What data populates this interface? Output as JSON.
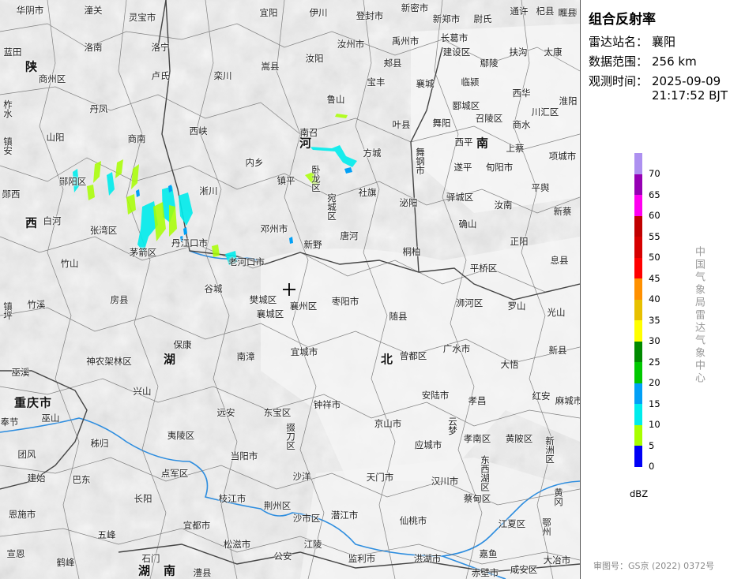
{
  "panel": {
    "title": "组合反射率",
    "station_label": "雷达站名：",
    "station_value": "襄阳",
    "range_label": "数据范围：",
    "range_value": "256 km",
    "time_label": "观测时间：",
    "time_date": "2025-09-09",
    "time_clock": "21:17:52 BJT",
    "agency": "中国气象局雷达气象中心",
    "approval": "审图号：GS京 (2022) 0372号"
  },
  "legend": {
    "unit": "dBZ",
    "ticks": [
      "70",
      "65",
      "60",
      "55",
      "50",
      "45",
      "40",
      "35",
      "30",
      "25",
      "20",
      "15",
      "10",
      "5",
      "0"
    ],
    "colors": [
      "#ad90f0",
      "#9600b4",
      "#ff00f0",
      "#c00000",
      "#d60000",
      "#ff0000",
      "#ff9000",
      "#e7c000",
      "#ffff00",
      "#008a00",
      "#00c800",
      "#01a0f6",
      "#00ecec",
      "#a8ff00",
      "#0000f6"
    ]
  },
  "regions": [
    "陕",
    "西",
    "重庆市",
    "湖",
    "北",
    "湖",
    "南",
    "河",
    "南"
  ],
  "places": [
    "华阴市",
    "潼关",
    "灵宝市",
    "偃师",
    "宜阳",
    "伊川",
    "登封市",
    "新密市",
    "新郑市",
    "尉氏",
    "通许",
    "杞县",
    "睢县",
    "蓝田",
    "洛南",
    "洛宁",
    "嵩县",
    "汝阳",
    "汝州市",
    "禹州市",
    "长葛市",
    "建设区",
    "鄢陵",
    "扶沟",
    "太康",
    "商州区",
    "卢氏",
    "栾川",
    "鲁山",
    "宝丰",
    "郏县",
    "襄城",
    "临颍",
    "西华",
    "柞水",
    "丹凤",
    "叶县",
    "郾城区",
    "召陵区",
    "商水",
    "川汇区",
    "淮阳",
    "山阳",
    "商南",
    "西峡",
    "南召",
    "舞阳",
    "西平",
    "上蔡",
    "项城市",
    "镇安",
    "内乡",
    "方城",
    "舞钢市",
    "遂平",
    "旬阳市",
    "郧西",
    "郧阳区",
    "淅川",
    "镇平",
    "卧龙区",
    "宛城区",
    "社旗",
    "泌阳",
    "驿城区",
    "平舆",
    "新蔡",
    "白河",
    "张湾区",
    "丹江口市",
    "邓州市",
    "唐河",
    "确山",
    "汝南",
    "正阳",
    "茅箭区",
    "竹山",
    "老河口市",
    "新野",
    "桐柏",
    "息县",
    "谷城",
    "平桥区",
    "罗山",
    "光山",
    "竹溪",
    "房县",
    "樊城区",
    "襄州区",
    "枣阳市",
    "浉河区",
    "镇坪",
    "襄城区",
    "随县",
    "保康",
    "南漳",
    "宜城市",
    "曾都区",
    "广水市",
    "大悟",
    "新县",
    "神农架林区",
    "巫溪",
    "兴山",
    "安陆市",
    "孝昌",
    "红安",
    "麻城市",
    "巫山",
    "远安",
    "东宝区",
    "钟祥市",
    "京山市",
    "云梦",
    "奉节",
    "秭归",
    "夷陵区",
    "掇刀区",
    "应城市",
    "孝南区",
    "黄陂区",
    "新洲区",
    "当阳市",
    "团风",
    "建始",
    "巴东",
    "点军区",
    "沙洋",
    "天门市",
    "汉川市",
    "东西湖区",
    "黄冈",
    "长阳",
    "枝江市",
    "荆州区",
    "潜江市",
    "蔡甸区",
    "恩施市",
    "宜都市",
    "沙市区",
    "仙桃市",
    "江夏区",
    "鄂州",
    "五峰",
    "松滋市",
    "江陵",
    "洪湖市",
    "宣恩",
    "鹤峰",
    "石门",
    "公安",
    "监利市",
    "嘉鱼",
    "咸安区",
    "赤壁市",
    "大冶市",
    "澧县"
  ],
  "radar_levels_dbz": [
    10,
    15,
    20
  ]
}
